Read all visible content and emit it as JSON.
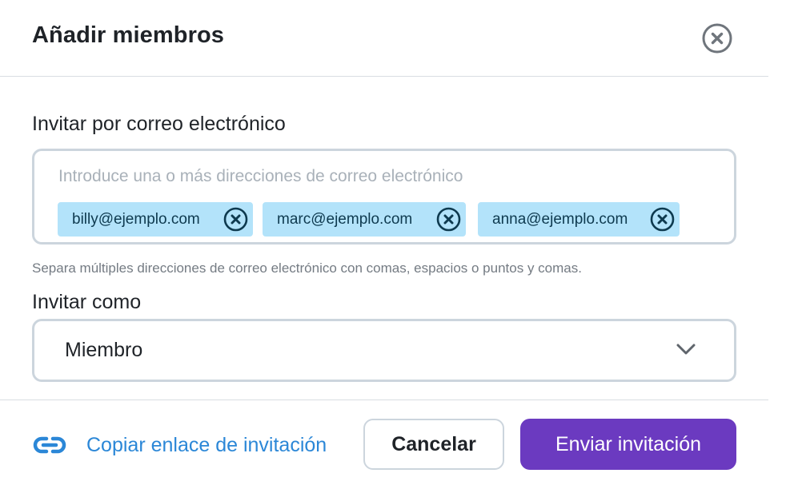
{
  "dialog": {
    "title": "Añadir miembros",
    "close_icon": "close-circle-icon"
  },
  "email": {
    "label": "Invitar por correo electrónico",
    "placeholder": "Introduce una o más direcciones de correo electrónico",
    "value": "",
    "chips": [
      {
        "email": "billy@ejemplo.com",
        "remove_icon": "remove-circle-icon"
      },
      {
        "email": "marc@ejemplo.com",
        "remove_icon": "remove-circle-icon"
      },
      {
        "email": "anna@ejemplo.com",
        "remove_icon": "remove-circle-icon"
      }
    ],
    "hint": "Separa múltiples direcciones de correo electrónico con comas, espacios o puntos y comas."
  },
  "role": {
    "label": "Invitar como",
    "selected": "Miembro",
    "icon": "chevron-down-icon"
  },
  "footer": {
    "copy_link_label": "Copiar enlace de invitación",
    "copy_link_icon": "link-icon",
    "cancel_label": "Cancelar",
    "send_label": "Enviar invitación"
  },
  "colors": {
    "accent": "#6b3ac0",
    "link": "#2b87d7",
    "chip_bg": "#b3e3fa",
    "chip_text": "#0e3a4f",
    "border": "#ccd5dd"
  }
}
